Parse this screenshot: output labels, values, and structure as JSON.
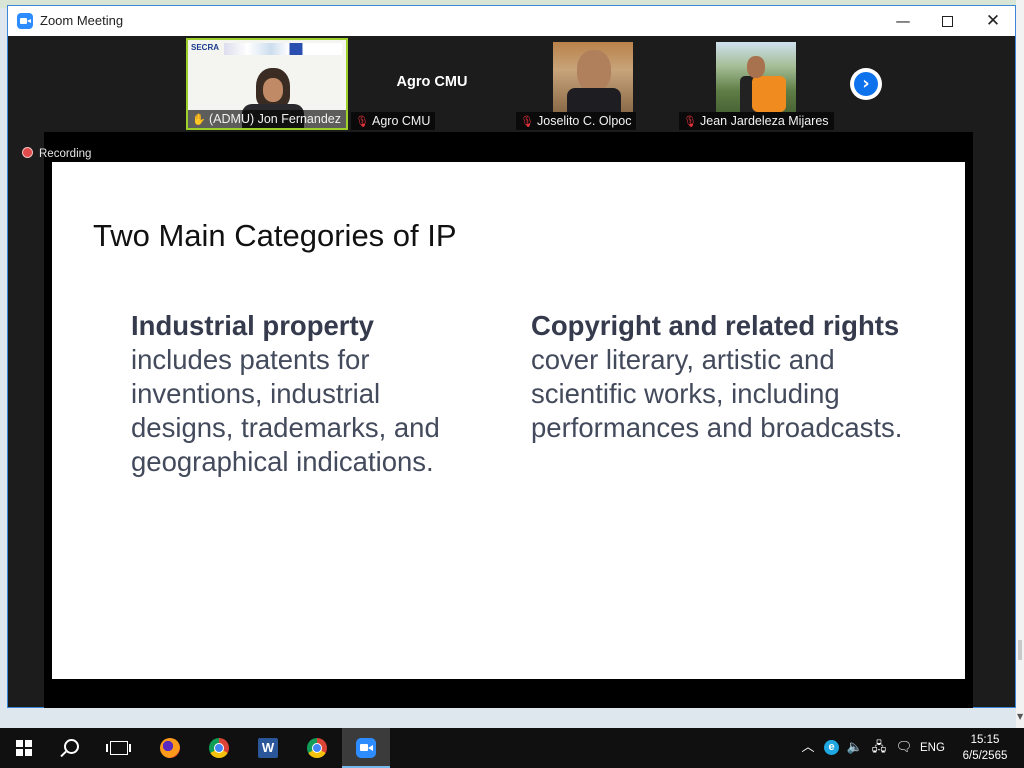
{
  "window": {
    "title": "Zoom Meeting"
  },
  "participants": [
    {
      "name": "(ADMU) Jon Fernandez",
      "muted": false,
      "active_speaker": true
    },
    {
      "name": "Agro CMU",
      "muted": true,
      "video": false,
      "display_name": "Agro CMU"
    },
    {
      "name": "Joselito C. Olpoc",
      "muted": true
    },
    {
      "name": "Jean Jardeleza Mijares",
      "muted": true
    }
  ],
  "tile1_slide": {
    "logo": "SECRA"
  },
  "recording": {
    "label": "Recording"
  },
  "slide": {
    "title": "Two Main Categories of IP",
    "left": {
      "heading": "Industrial property",
      "body": "includes patents for inventions, industrial designs, trademarks, and geographical indications."
    },
    "right": {
      "heading": "Copyright and related rights",
      "body": "cover literary, artistic and scientific works, including performances and broadcasts."
    }
  },
  "taskbar": {
    "apps": [
      "start-icon",
      "search-icon",
      "task-view-icon",
      "firefox-icon",
      "chrome-icon",
      "word-icon",
      "chrome-icon",
      "zoom-icon"
    ],
    "word_letter": "W",
    "tray": {
      "language": "ENG",
      "time": "15:15",
      "date": "6/5/2565"
    }
  },
  "colors": {
    "accent": "#2d8cff",
    "active_speaker_border": "#9fcf2a",
    "muted_icon": "#e8323c",
    "recording_dot": "#e14b4b"
  }
}
